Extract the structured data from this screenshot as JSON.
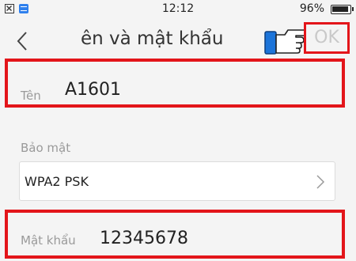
{
  "status_bar": {
    "time": "12:12",
    "battery": "96%",
    "left_icons": [
      "close-box-icon",
      "app-notification-icon"
    ]
  },
  "nav": {
    "title": "ên và mật khẩu",
    "ok_label": "OK",
    "icons": [
      "back-chevron-icon",
      "pointing-hand-icon"
    ]
  },
  "fields": {
    "name": {
      "label": "Tên",
      "value": "A1601"
    },
    "security": {
      "label": "Bảo mật",
      "value": "WPA2 PSK"
    },
    "password": {
      "label": "Mật khẩu",
      "value": "12345678"
    }
  },
  "colors": {
    "highlight": "#e3151a",
    "background": "#f4f4f4",
    "label": "#9a9a9a",
    "text": "#222222",
    "ok_disabled": "#c9c9c9"
  }
}
